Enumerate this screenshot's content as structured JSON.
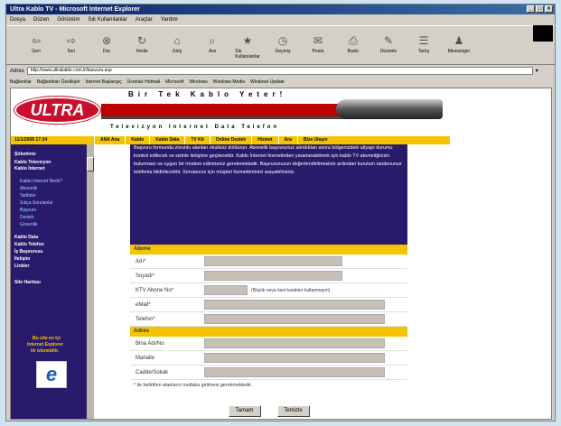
{
  "window": {
    "title": "Ultra Kablo TV - Microsoft Internet Explorer"
  },
  "menu": [
    "Dosya",
    "Düzen",
    "Görünüm",
    "Sık Kullanılanlar",
    "Araçlar",
    "Yardım"
  ],
  "toolbar": [
    {
      "label": "Geri",
      "icon": "back-arrow-icon"
    },
    {
      "label": "İleri",
      "icon": "forward-arrow-icon"
    },
    {
      "label": "Dur",
      "icon": "stop-icon"
    },
    {
      "label": "Yenile",
      "icon": "refresh-icon"
    },
    {
      "label": "Giriş",
      "icon": "home-icon"
    },
    {
      "label": "Ara",
      "icon": "search-icon"
    },
    {
      "label": "Sık Kullanılanlar",
      "icon": "favorites-icon"
    },
    {
      "label": "Geçmiş",
      "icon": "history-icon"
    },
    {
      "label": "Posta",
      "icon": "mail-icon"
    },
    {
      "label": "Baskı",
      "icon": "print-icon"
    },
    {
      "label": "Düzenle",
      "icon": "edit-icon"
    },
    {
      "label": "Tartış",
      "icon": "discuss-icon"
    },
    {
      "label": "Messenger",
      "icon": "messenger-icon"
    }
  ],
  "address": {
    "label": "Adres",
    "value": "http://www.ultrakablo.com.tr/basvuru.asp"
  },
  "links": [
    "Bağlantılar",
    "Bağlantıları Özelleştir",
    "Internet Başlangıç",
    "Ücretsiz Hotmail",
    "Microsoft",
    "Windows",
    "Windows Media",
    "Windows Update"
  ],
  "banner": {
    "logo": "ULTRA",
    "slogan": "Bir Tek Kablo Yeter!",
    "subslogan": "Televizyon Internet Data Telefon"
  },
  "navbar": {
    "date": "11/1/2008 17:24",
    "items": [
      "ANA Ana",
      "Kablo",
      "Kablo Data",
      "TV Kit",
      "Online Destek",
      "Hizmet",
      "Ara",
      "Bize Ulaşın"
    ]
  },
  "sidebar": {
    "items": [
      "Şirketimiz",
      "Kablo Televizyon",
      "Kablo İnternet",
      "Kablo Data",
      "Kablo Telefon",
      "İş Başvurusu",
      "İletişim",
      "Linkler",
      "Site Haritası"
    ],
    "subitems": [
      "Kablo Internet Nedir?",
      "Abonelik",
      "Tarifeler",
      "Sıkça Sorulanlar",
      "Başvuru",
      "Destek",
      "Güvenlik"
    ],
    "cta": [
      "Bu site en iyi",
      "Internet Explorer",
      "ile izlenebilir."
    ]
  },
  "intro": "Başvuru formunda zorunlu alanları eksiksiz doldurun. Abonelik başvurunuz alındıktan sonra bölgenizdeki altyapı durumu kontrol edilecek ve sizinle iletişime geçilecektir. Kablo İnternet hizmetinden yararlanabilmek için kablo TV aboneliğinizin bulunması ve uygun bir modem edinmeniz gerekmektedir. Başvurunuzun değerlendirilmesinin ardından kurulum randevunuz telefonla bildirilecektir. Sorularınız için müşteri hizmetlerimizi arayabilirsiniz.",
  "sections": {
    "abone": "Abone",
    "adres": "Adres"
  },
  "fields": {
    "name": "Adı*",
    "surname": "Soyadı*",
    "ktv": "KTV Abone No*",
    "ktv_hint": "(Büyük veya özel karakter kullanmayın)",
    "email": "eMail*",
    "phone": "Telefon*",
    "building": "Bina Adı/No",
    "district": "Mahalle",
    "street": "Cadde/Sokak"
  },
  "note": "* ile belirtilen alanların mutlaka girilmesi gerekmektedir.",
  "buttons": {
    "submit": "Tamam",
    "reset": "Temizle"
  }
}
